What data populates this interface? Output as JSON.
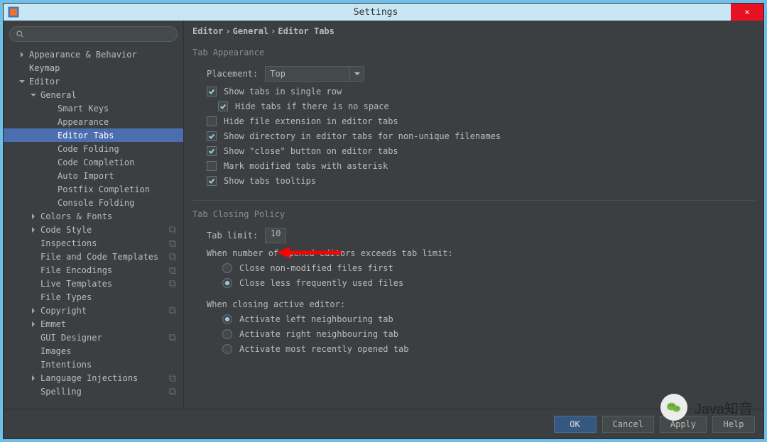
{
  "window": {
    "title": "Settings",
    "close_label": "×"
  },
  "breadcrumb": [
    "Editor",
    "General",
    "Editor Tabs"
  ],
  "sidebar": {
    "items": [
      {
        "label": "Appearance & Behavior",
        "level": 0,
        "arrow": "right",
        "selected": false,
        "badge": false
      },
      {
        "label": "Keymap",
        "level": 0,
        "arrow": "none",
        "selected": false,
        "badge": false
      },
      {
        "label": "Editor",
        "level": 0,
        "arrow": "down",
        "selected": false,
        "badge": false
      },
      {
        "label": "General",
        "level": 1,
        "arrow": "down",
        "selected": false,
        "badge": false
      },
      {
        "label": "Smart Keys",
        "level": 2,
        "arrow": "none",
        "selected": false,
        "badge": false
      },
      {
        "label": "Appearance",
        "level": 2,
        "arrow": "none",
        "selected": false,
        "badge": false
      },
      {
        "label": "Editor Tabs",
        "level": 2,
        "arrow": "none",
        "selected": true,
        "badge": false
      },
      {
        "label": "Code Folding",
        "level": 2,
        "arrow": "none",
        "selected": false,
        "badge": false
      },
      {
        "label": "Code Completion",
        "level": 2,
        "arrow": "none",
        "selected": false,
        "badge": false
      },
      {
        "label": "Auto Import",
        "level": 2,
        "arrow": "none",
        "selected": false,
        "badge": false
      },
      {
        "label": "Postfix Completion",
        "level": 2,
        "arrow": "none",
        "selected": false,
        "badge": false
      },
      {
        "label": "Console Folding",
        "level": 2,
        "arrow": "none",
        "selected": false,
        "badge": false
      },
      {
        "label": "Colors & Fonts",
        "level": 1,
        "arrow": "right",
        "selected": false,
        "badge": false
      },
      {
        "label": "Code Style",
        "level": 1,
        "arrow": "right",
        "selected": false,
        "badge": true
      },
      {
        "label": "Inspections",
        "level": 1,
        "arrow": "none",
        "selected": false,
        "badge": true
      },
      {
        "label": "File and Code Templates",
        "level": 1,
        "arrow": "none",
        "selected": false,
        "badge": true
      },
      {
        "label": "File Encodings",
        "level": 1,
        "arrow": "none",
        "selected": false,
        "badge": true
      },
      {
        "label": "Live Templates",
        "level": 1,
        "arrow": "none",
        "selected": false,
        "badge": true
      },
      {
        "label": "File Types",
        "level": 1,
        "arrow": "none",
        "selected": false,
        "badge": false
      },
      {
        "label": "Copyright",
        "level": 1,
        "arrow": "right",
        "selected": false,
        "badge": true
      },
      {
        "label": "Emmet",
        "level": 1,
        "arrow": "right",
        "selected": false,
        "badge": false
      },
      {
        "label": "GUI Designer",
        "level": 1,
        "arrow": "none",
        "selected": false,
        "badge": true
      },
      {
        "label": "Images",
        "level": 1,
        "arrow": "none",
        "selected": false,
        "badge": false
      },
      {
        "label": "Intentions",
        "level": 1,
        "arrow": "none",
        "selected": false,
        "badge": false
      },
      {
        "label": "Language Injections",
        "level": 1,
        "arrow": "right",
        "selected": false,
        "badge": true
      },
      {
        "label": "Spelling",
        "level": 1,
        "arrow": "none",
        "selected": false,
        "badge": true
      }
    ]
  },
  "tab_appearance": {
    "group": "Tab Appearance",
    "placement_label": "Placement:",
    "placement_value": "Top",
    "single_row": {
      "checked": true,
      "label": "Show tabs in single row"
    },
    "hide_no_space": {
      "checked": true,
      "label": "Hide tabs if there is no space"
    },
    "hide_ext": {
      "checked": false,
      "label": "Hide file extension in editor tabs"
    },
    "show_dir": {
      "checked": true,
      "label": "Show directory in editor tabs for non-unique filenames"
    },
    "show_close": {
      "checked": true,
      "label": "Show \"close\" button on editor tabs"
    },
    "mark_asterisk": {
      "checked": false,
      "label": "Mark modified tabs with asterisk"
    },
    "tooltips": {
      "checked": true,
      "label": "Show tabs tooltips"
    }
  },
  "closing_policy": {
    "group": "Tab Closing Policy",
    "tab_limit_label": "Tab limit:",
    "tab_limit_value": "10",
    "exceed_label": "When number of opened editors exceeds tab limit:",
    "radio_exceed": [
      {
        "checked": false,
        "label": "Close non-modified files first"
      },
      {
        "checked": true,
        "label": "Close less frequently used files"
      }
    ],
    "closing_active_label": "When closing active editor:",
    "radio_active": [
      {
        "checked": true,
        "label": "Activate left neighbouring tab"
      },
      {
        "checked": false,
        "label": "Activate right neighbouring tab"
      },
      {
        "checked": false,
        "label": "Activate most recently opened tab"
      }
    ]
  },
  "footer": {
    "ok": "OK",
    "cancel": "Cancel",
    "apply": "Apply",
    "help": "Help"
  },
  "watermark": "Java知音"
}
